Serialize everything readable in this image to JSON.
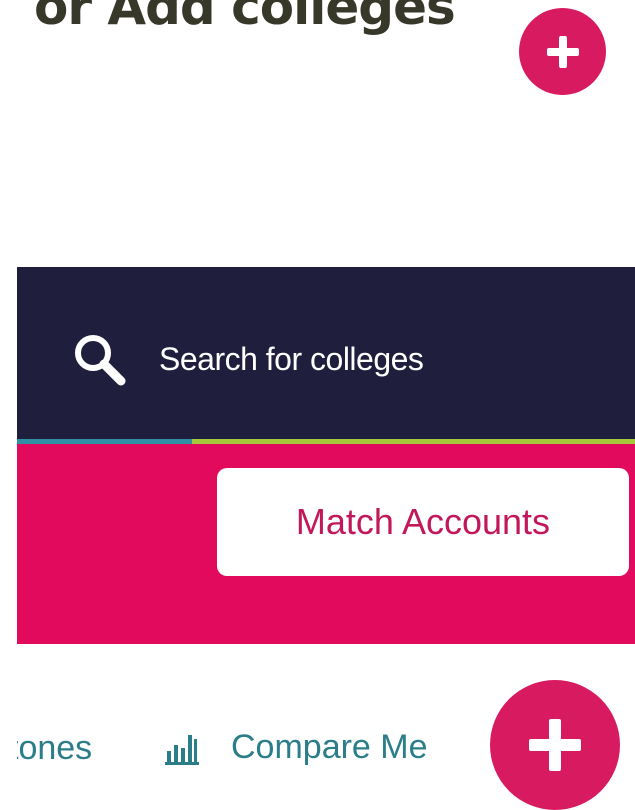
{
  "heading": {
    "text": "or Add colleges"
  },
  "navbar": {
    "search_label": "Search for colleges",
    "search_icon": "search-icon"
  },
  "action_band": {
    "match_accounts_label": "Match Accounts"
  },
  "tabs": {
    "partial_tab_label": "tones",
    "compare_label": "Compare Me",
    "compare_icon": "bar-chart-icon"
  },
  "colors": {
    "navy": "#1f1f3d",
    "pink": "#e10a5d",
    "fab_pink": "#d81b60",
    "teal": "#2c7d8a",
    "lime": "#a8c83c",
    "heading": "#38382a"
  }
}
